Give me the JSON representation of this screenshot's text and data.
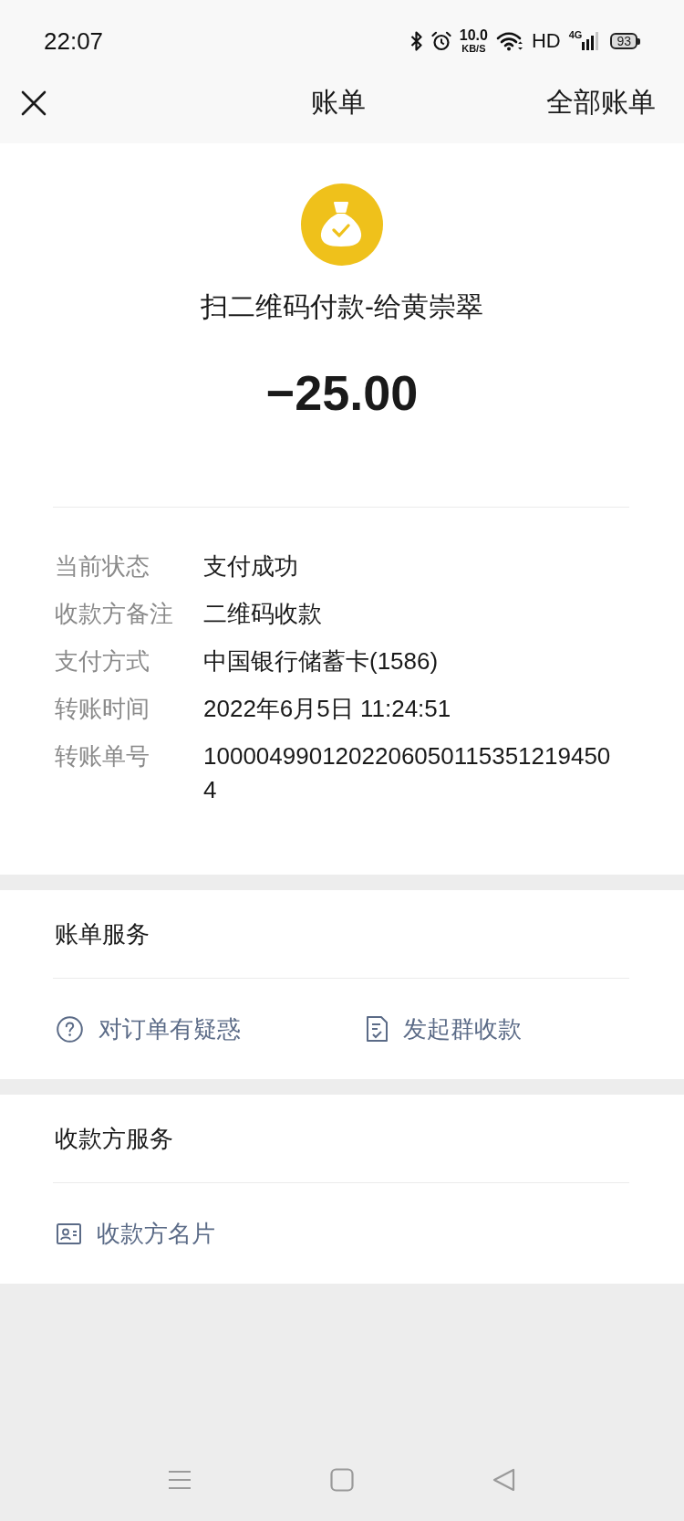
{
  "status_bar": {
    "time": "22:07",
    "speed": "10.0",
    "speed_unit": "KB/S",
    "hd": "HD",
    "network": "4G",
    "battery": "93"
  },
  "nav_bar": {
    "title": "账单",
    "action": "全部账单"
  },
  "summary": {
    "title": "扫二维码付款-给黄崇翠",
    "amount": "−25.00"
  },
  "details": [
    {
      "label": "当前状态",
      "value": "支付成功"
    },
    {
      "label": "收款方备注",
      "value": "二维码收款"
    },
    {
      "label": "支付方式",
      "value": "中国银行储蓄卡(1586)"
    },
    {
      "label": "转账时间",
      "value": "2022年6月5日 11:24:51"
    },
    {
      "label": "转账单号",
      "value": "10000499012022060501153512194504"
    }
  ],
  "sections": [
    {
      "title": "账单服务",
      "items": [
        {
          "kind": "question",
          "label": "对订单有疑惑"
        },
        {
          "kind": "split",
          "label": "发起群收款"
        }
      ]
    },
    {
      "title": "收款方服务",
      "items": [
        {
          "kind": "card",
          "label": "收款方名片"
        }
      ]
    }
  ]
}
